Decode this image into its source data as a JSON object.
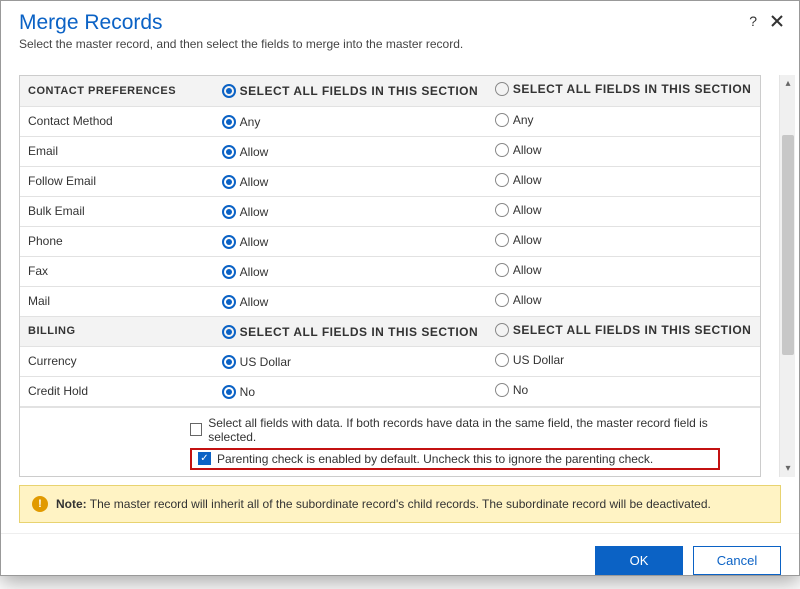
{
  "header": {
    "title": "Merge Records",
    "subtitle": "Select the master record, and then select the fields to merge into the master record."
  },
  "section_header_radio": "Select all fields in this section",
  "sections": [
    {
      "title": "CONTACT PREFERENCES",
      "rows": [
        {
          "label": "Contact Method",
          "left": "Any",
          "right": "Any"
        },
        {
          "label": "Email",
          "left": "Allow",
          "right": "Allow"
        },
        {
          "label": "Follow Email",
          "left": "Allow",
          "right": "Allow"
        },
        {
          "label": "Bulk Email",
          "left": "Allow",
          "right": "Allow"
        },
        {
          "label": "Phone",
          "left": "Allow",
          "right": "Allow"
        },
        {
          "label": "Fax",
          "left": "Allow",
          "right": "Allow"
        },
        {
          "label": "Mail",
          "left": "Allow",
          "right": "Allow"
        }
      ]
    },
    {
      "title": "BILLING",
      "rows": [
        {
          "label": "Currency",
          "left": "US Dollar",
          "right": "US Dollar"
        },
        {
          "label": "Credit Hold",
          "left": "No",
          "right": "No"
        }
      ]
    }
  ],
  "checks": {
    "select_all_data": "Select all fields with data. If both records have data in the same field, the master record field is selected.",
    "parenting": "Parenting check is enabled by default. Uncheck this to ignore the parenting check."
  },
  "note": {
    "prefix": "Note:",
    "body": "The master record will inherit all of the subordinate record's child records. The subordinate record will be deactivated."
  },
  "buttons": {
    "ok": "OK",
    "cancel": "Cancel"
  }
}
